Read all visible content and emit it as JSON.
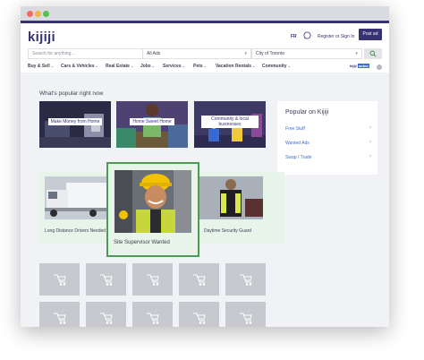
{
  "header": {
    "logo": "kijiji",
    "language": "FR",
    "register_label": "Register or Sign In",
    "post_ad_label": "Post ad"
  },
  "search": {
    "placeholder": "Search for anything...",
    "category": "All Ads",
    "location": "City of Toronto"
  },
  "nav": {
    "items": [
      "Buy & Sell",
      "Cars & Vehicles",
      "Real Estate",
      "Jobs",
      "Services",
      "Pets",
      "Vacation Rentals",
      "Community"
    ],
    "autos_label": "kijiji",
    "autos_tag": "autos"
  },
  "popular": {
    "title": "What's popular right now",
    "tiles": [
      "Make Money from Home",
      "Home Sweet Home",
      "Community & local businesses"
    ]
  },
  "sidebar": {
    "title": "Popular on Kijiji",
    "items": [
      "Free Stuff",
      "Wanted Ads",
      "Swap / Trade"
    ]
  },
  "jobs": {
    "left_caption": "Long Distance Drivers Needed",
    "featured_caption": "Site Supervisor Wanted",
    "right_caption": "Daytime Security Guard"
  },
  "colors": {
    "brand": "#373373",
    "link": "#3c6fd1",
    "featured_border": "#4f9a54"
  }
}
